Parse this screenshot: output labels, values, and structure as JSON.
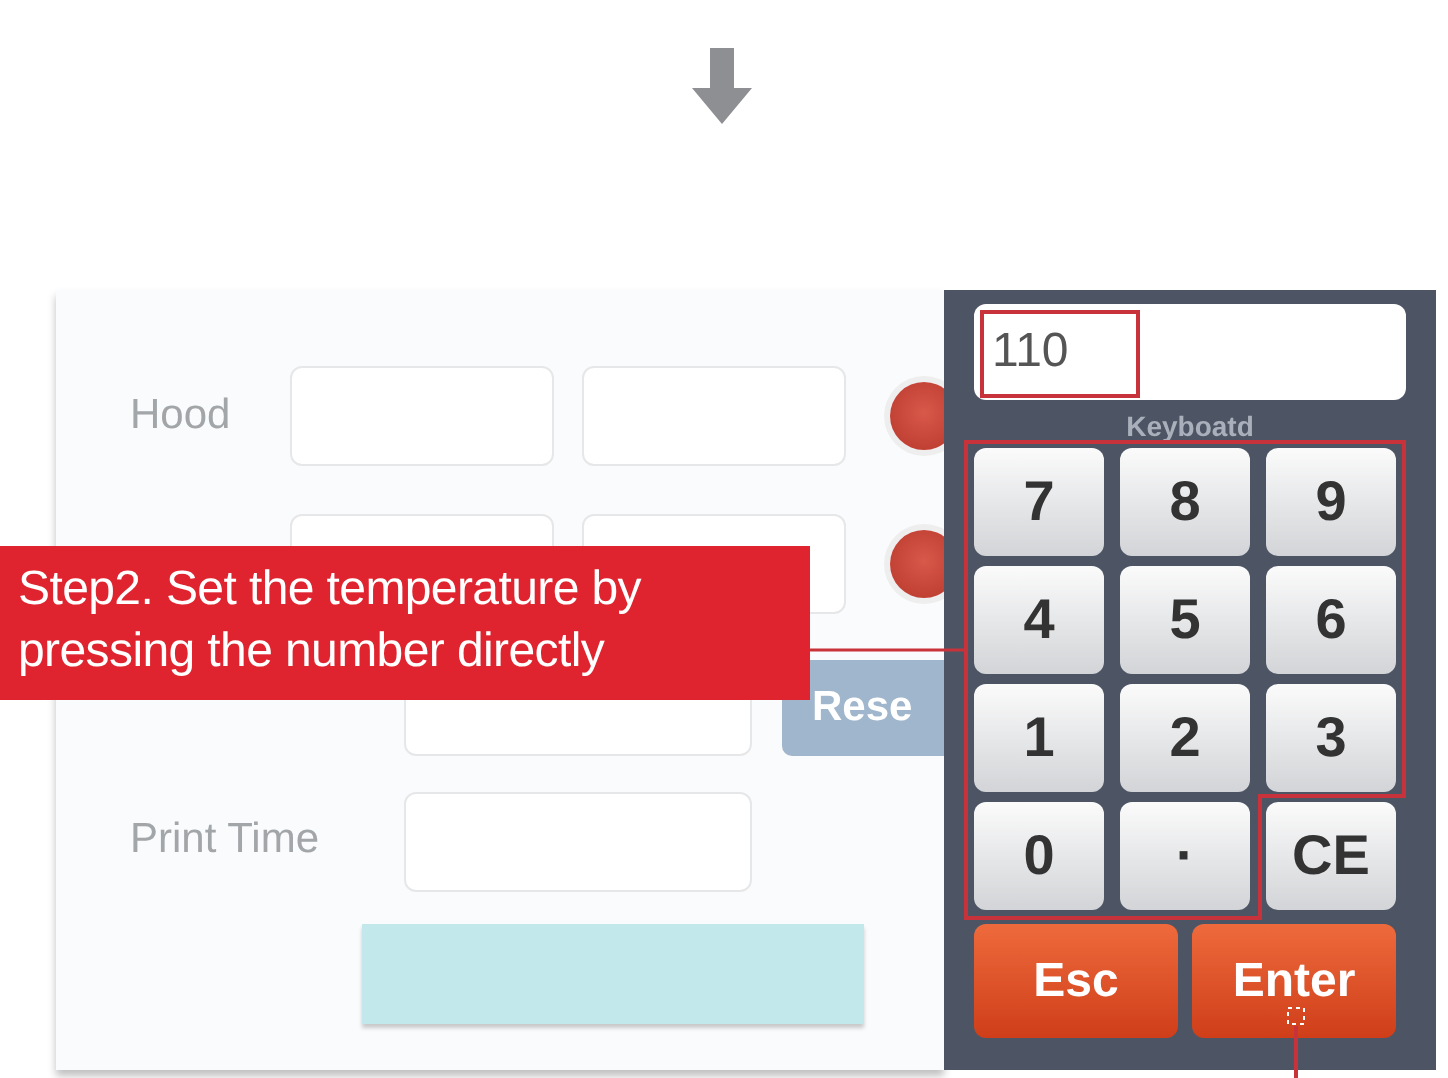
{
  "callout": {
    "text": "Step2. Set the temperature by pressing the number directly"
  },
  "form": {
    "rows": [
      {
        "label": "Hood",
        "kind": "double"
      },
      {
        "kind": "double"
      },
      {
        "kind": "single",
        "button": "Rese"
      },
      {
        "label": "Print Time",
        "kind": "single"
      }
    ]
  },
  "keypad": {
    "value": "110",
    "title": "Keyboatd",
    "keys": [
      "7",
      "8",
      "9",
      "4",
      "5",
      "6",
      "1",
      "2",
      "3",
      "0",
      "·",
      "CE"
    ],
    "actions": [
      "Esc",
      "Enter"
    ]
  }
}
